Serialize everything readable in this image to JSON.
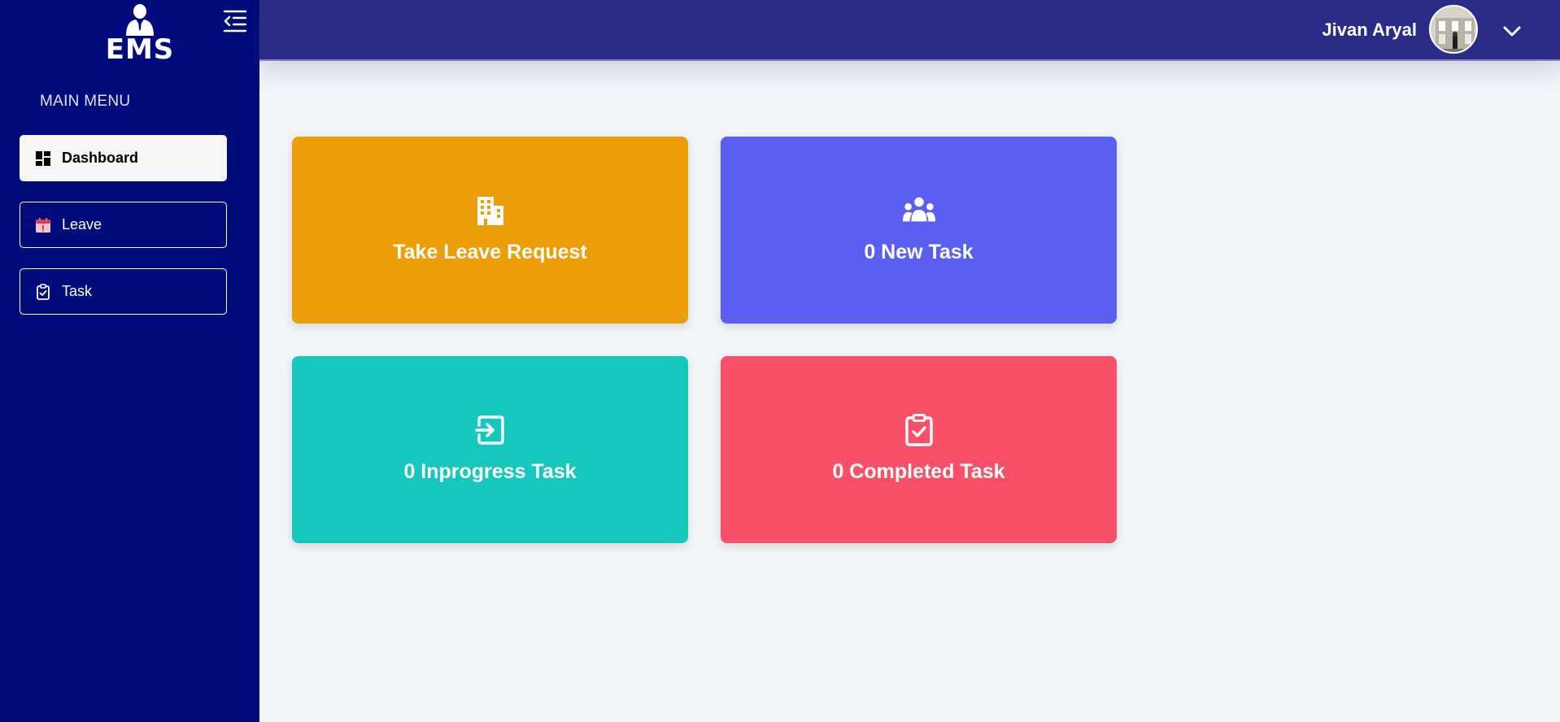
{
  "app": {
    "logo_text": "EMS"
  },
  "sidebar": {
    "menu_heading": "MAIN MENU",
    "items": [
      {
        "label": "Dashboard",
        "icon": "dashboard-icon",
        "active": true
      },
      {
        "label": "Leave",
        "icon": "calendar-icon",
        "active": false
      },
      {
        "label": "Task",
        "icon": "clipboard-check-icon",
        "active": false
      }
    ]
  },
  "header": {
    "user_name": "Jivan Aryal"
  },
  "cards": [
    {
      "label": "Take Leave Request",
      "icon": "building-icon",
      "color": "#eb9e08"
    },
    {
      "label": "0 New Task",
      "icon": "users-icon",
      "color": "#5b5ff1"
    },
    {
      "label": "0 Inprogress Task",
      "icon": "arrow-in-box-icon",
      "color": "#16c7bd"
    },
    {
      "label": "0 Completed Task",
      "icon": "clipboard-check-icon",
      "color": "#f75068"
    }
  ],
  "colors": {
    "sidebar_bg": "#000c7c",
    "header_bg": "#2a2c88",
    "page_bg": "#f1f4f9"
  }
}
